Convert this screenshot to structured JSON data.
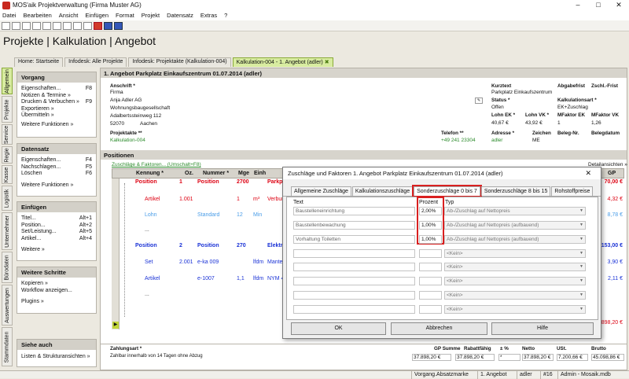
{
  "window": {
    "title": "MOS'aik Projektverwaltung (Firma Muster AG)",
    "min": "–",
    "max": "□",
    "close": "✕"
  },
  "menu": [
    "Datei",
    "Bearbeiten",
    "Ansicht",
    "Einfügen",
    "Format",
    "Projekt",
    "Datensatz",
    "Extras",
    "?"
  ],
  "app_title": "Projekte | Kalkulation | Angebot",
  "doc_tabs": [
    "Home: Startseite",
    "Infodesk: Alle Projekte",
    "Infodesk: Projektakte (Kalkulation-004)",
    "Kalkulation-004 - 1. Angebot (adler)"
  ],
  "vtabs": [
    "Allgemein",
    "Projekte",
    "Service",
    "Regie",
    "Kasse",
    "Logistik",
    "Unternehmer",
    "Bürodaten",
    "Auswertungen",
    "Stammdaten"
  ],
  "panels": {
    "vorgang": {
      "title": "Vorgang",
      "items": [
        [
          "Eigenschaften...",
          "F8"
        ],
        [
          "Notizen & Termine »",
          ""
        ],
        [
          "Drucken & Verbuchen »",
          "F9"
        ],
        [
          "Exportieren »",
          ""
        ],
        [
          "Übermitteln »",
          ""
        ]
      ],
      "more": "Weitere Funktionen »"
    },
    "datensatz": {
      "title": "Datensatz",
      "items": [
        [
          "Eigenschaften...",
          "F4"
        ],
        [
          "Nachschlagen...",
          "F5"
        ],
        [
          "Löschen",
          "F6"
        ]
      ],
      "more": "Weitere Funktionen »"
    },
    "einfuegen": {
      "title": "Einfügen",
      "items": [
        [
          "Titel...",
          "Alt+1"
        ],
        [
          "Position...",
          "Alt+2"
        ],
        [
          "Set/Leistung...",
          "Alt+5"
        ],
        [
          "Artikel...",
          "Alt+4"
        ]
      ],
      "more": "Weitere »"
    },
    "weitere": {
      "title": "Weitere Schritte",
      "items": [
        [
          "Kopieren »",
          ""
        ],
        [
          "Workflow anzeigen...",
          ""
        ],
        [
          "Plugins »",
          ""
        ]
      ]
    },
    "siehe": {
      "title": "Siehe auch",
      "items": [
        [
          "Listen & Strukturansichten »",
          ""
        ]
      ]
    }
  },
  "header": {
    "section": "1. Angebot Parkplatz Einkaufszentrum 01.07.2014 (adler)",
    "anschrift_label": "Anschrift *",
    "anschrift": [
      "Firma",
      "Anja Adler AG",
      "Wohnungsbaugesellschaft",
      "Adalbertssteinweg 112"
    ],
    "plz": "52070",
    "ort": "Aachen",
    "kurztext_label": "Kurztext",
    "kurztext": "Parkplatz Einkaufszentrum",
    "abgabefrist_label": "Abgabefrist",
    "zschl_label": "Zschl.-Frist",
    "status_label": "Status *",
    "status": "Offen",
    "kalkart_label": "Kalkulationsart *",
    "kalkart": "EK+Zuschlag",
    "lohnek_label": "Lohn EK *",
    "lohnek": "40,67 €",
    "lohnvk_label": "Lohn VK *",
    "lohnvk": "43,92 €",
    "mfek_label": "MFaktor EK",
    "mfek": "1",
    "mfvk_label": "MFaktor VK",
    "mfvk": "1,26",
    "projektakte_label": "Projektakte **",
    "projektakte": "Kalkulation-004",
    "telefon_label": "Telefon **",
    "telefon": "+49 241 23304",
    "adresse_label": "Adresse *",
    "adresse": "adler",
    "zeichen_label": "Zeichen",
    "zeichen": "ME",
    "belegnr_label": "Beleg-Nr.",
    "belegdatum_label": "Belegdatum"
  },
  "positionen": {
    "section": "Positionen",
    "link": "Zuschläge & Faktoren... (Umschalt+F8)",
    "detail": "Detailansichten »",
    "cols": [
      "Kennung *",
      "Oz.",
      "Nummer *",
      "Mge",
      "Einh",
      "Text"
    ],
    "rows": [
      {
        "kennung": "Position",
        "oz": "1",
        "nummer": "Position",
        "mge": "2700",
        "einh": "",
        "text": "Parkpl",
        "price": "70,00 €",
        "cls": "red",
        "bold": true
      },
      {
        "kennung": "Artikel",
        "oz": "1.001",
        "nummer": "",
        "mge": "1",
        "einh": "m³",
        "text": "Verbund",
        "price": "4,32 €",
        "cls": "red",
        "bold": false
      },
      {
        "kennung": "Lohn",
        "oz": "",
        "nummer": "Standard",
        "mge": "12",
        "einh": "Min",
        "text": "",
        "price": "8,78 €",
        "cls": "lblue",
        "bold": false
      },
      {
        "kennung": "...",
        "oz": "",
        "nummer": "",
        "mge": "",
        "einh": "",
        "text": "",
        "price": "",
        "cls": "",
        "bold": false
      },
      {
        "kennung": "Position",
        "oz": "2",
        "nummer": "Position",
        "mge": "270",
        "einh": "",
        "text": "Elektro",
        "price": "153,00 €",
        "cls": "blue",
        "bold": true
      },
      {
        "kennung": "Set",
        "oz": "2.001",
        "nummer": "e-ka 009",
        "mge": "",
        "einh": "lfdm",
        "text": "Mantell",
        "price": "3,90 €",
        "cls": "blue",
        "bold": false
      },
      {
        "kennung": "Artikel",
        "oz": "",
        "nummer": "e-1007",
        "mge": "1,1",
        "einh": "lfdm",
        "text": "NYM 4x",
        "price": "2,11 €",
        "cls": "blue",
        "bold": false
      },
      {
        "kennung": "...",
        "oz": "",
        "nummer": "",
        "mge": "",
        "einh": "",
        "text": "",
        "price": "",
        "cls": "",
        "bold": false
      },
      {
        "kennung": "",
        "oz": "",
        "nummer": "",
        "mge": "",
        "einh": "",
        "text": "",
        "price": "898,20 €",
        "cls": "red",
        "bold": false
      }
    ],
    "gp_col": "GP"
  },
  "footer": {
    "zahlungsart_label": "Zahlungsart *",
    "zahlungsart": "Zahlbar innerhalb von 14 Tagen ohne Abzug",
    "gp_label": "GP Summe",
    "gp": "37.898,20 €",
    "rab_label": "Rabattfähig",
    "rab": "37.898,20 €",
    "pct_label": "± %",
    "pct": "*",
    "netto_label": "Netto",
    "netto": "37.898,20 €",
    "ust_label": "USt.",
    "ust": "7.200,66 €",
    "brutto_label": "Brutto",
    "brutto": "45.098,86 €"
  },
  "dialog": {
    "title": "Zuschläge und Faktoren 1. Angebot Parkplatz Einkaufszentrum 01.07.2014 (adler)",
    "tabs": [
      "Allgemeine Zuschläge",
      "Kalkulationszuschläge",
      "Sonderzuschläge 0 bis 7",
      "Sonderzuschläge 8 bis 15",
      "Rohstoffpreise"
    ],
    "col_text": "Text",
    "col_prozent": "Prozent",
    "col_typ": "Typ",
    "rows": [
      {
        "text": "Baustelleneinrichtung",
        "pct": "2,00%",
        "typ": "Ab-/Zuschlag auf Nettopreis"
      },
      {
        "text": "Baustellenbewachung",
        "pct": "1,00%",
        "typ": "Ab-/Zuschlag auf Nettopreis (aufbauend)"
      },
      {
        "text": "Vorhaltung Toiletten",
        "pct": "1,00%",
        "typ": "Ab-/Zuschlag auf Nettopreis (aufbauend)"
      },
      {
        "text": "",
        "pct": "",
        "typ": "<Kein>"
      },
      {
        "text": "",
        "pct": "",
        "typ": "<Kein>"
      },
      {
        "text": "",
        "pct": "",
        "typ": "<Kein>"
      },
      {
        "text": "",
        "pct": "",
        "typ": "<Kein>"
      },
      {
        "text": "",
        "pct": "",
        "typ": "<Kein>"
      }
    ],
    "ok": "OK",
    "cancel": "Abbrechen",
    "help": "Hilfe"
  },
  "statusbar": [
    "Vorgang.Absatzmarke",
    "1. Angebot",
    "adler",
    "#16",
    "Admin - Mosaik.mdb"
  ]
}
